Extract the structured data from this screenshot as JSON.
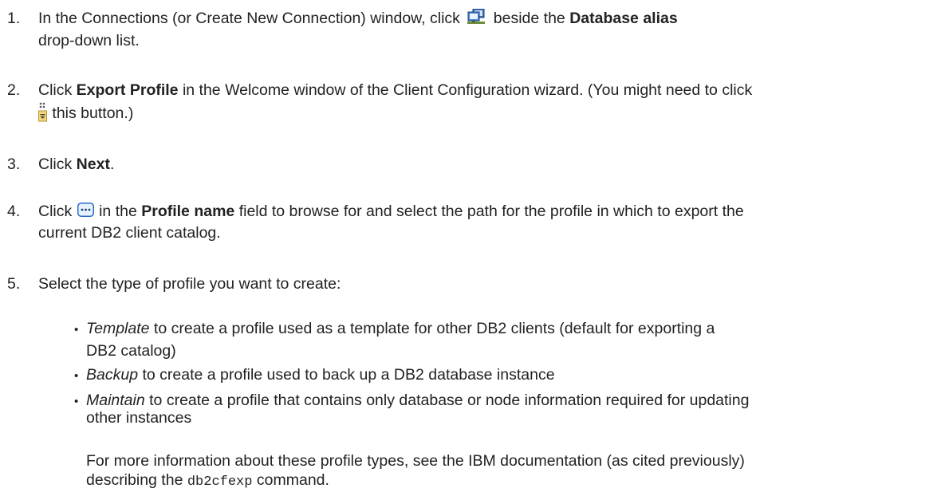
{
  "steps": [
    {
      "number": "1.",
      "line1_text_a": "In the Connections (or Create New Connection) window, click",
      "line1_text_b": "beside the",
      "line1_bold": "Database alias",
      "line2_text": "drop-down list.",
      "icon": "network-computer-icon"
    },
    {
      "number": "2.",
      "text_a": "Click",
      "bold": "Export Profile",
      "text_b": "in  the Welcome window of the Client Configuration wizard. (You might need to click",
      "line2_text": "this button.)",
      "icon": "expand-toolbar-icon"
    },
    {
      "number": "3.",
      "text_a": "Click",
      "bold": "Next",
      "text_b": "."
    },
    {
      "number": "4.",
      "text_a": "Click",
      "text_b": "in the",
      "bold": "Profile name",
      "text_c": "field to browse for and select the path for the profile in which to export the",
      "line2_text": "current DB2 client catalog.",
      "icon": "ellipsis-browse-icon"
    },
    {
      "number": "5.",
      "text": "Select the type of profile you want to create:"
    }
  ],
  "profile_types": [
    {
      "name": "Template",
      "line1": "to create a profile used as a template for other DB2 clients (default for exporting a",
      "line2": "DB2 catalog)"
    },
    {
      "name": "Backup",
      "line1": "to create a profile used to back up a DB2 database instance",
      "line2": ""
    },
    {
      "name": "Maintain",
      "line1": "to create a profile that contains only database or node information required for updating",
      "line2": "other instances"
    }
  ],
  "note": {
    "line1": "For more information about these profile types, see the IBM documentation (as cited previously)",
    "line2_a": "describing the",
    "command": "db2cfexp",
    "line2_b": "command."
  },
  "bullet_char": "•"
}
